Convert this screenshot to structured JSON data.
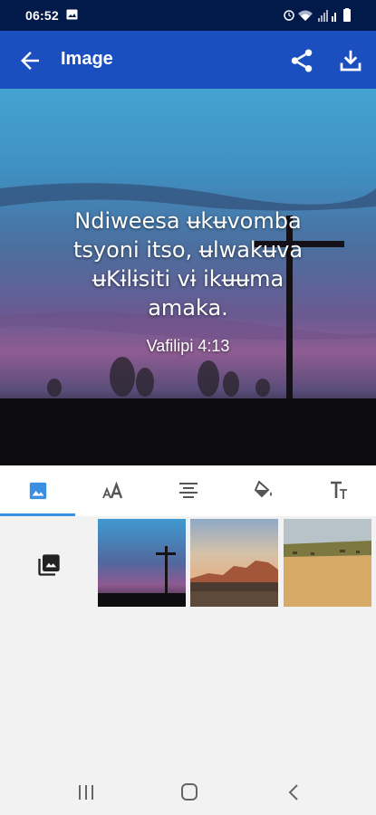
{
  "status_bar": {
    "time": "06:52"
  },
  "app_bar": {
    "title": "Image"
  },
  "preview": {
    "verse_line1": "Ndiweesa ʉkʉvomba",
    "verse_line2": "tsyoni itso, ʉlwakʉva",
    "verse_line3": "ʉKɨlɨsiti vɨ ikʉʉma",
    "verse_line4": "amaka.",
    "reference": "Vafilipi 4:13"
  },
  "toolbar": {
    "tabs": [
      "image-tab",
      "font-tab",
      "align-tab",
      "color-tab",
      "text-size-tab"
    ],
    "active_tab": "image-tab",
    "accent_color": "#3b8fe0"
  },
  "gallery": {
    "thumbnails": [
      "cross-at-dusk",
      "red-rock-desert",
      "savanna-plain"
    ]
  },
  "colors": {
    "app_bar": "#1b4fbf",
    "status_bar": "#021a4a"
  }
}
